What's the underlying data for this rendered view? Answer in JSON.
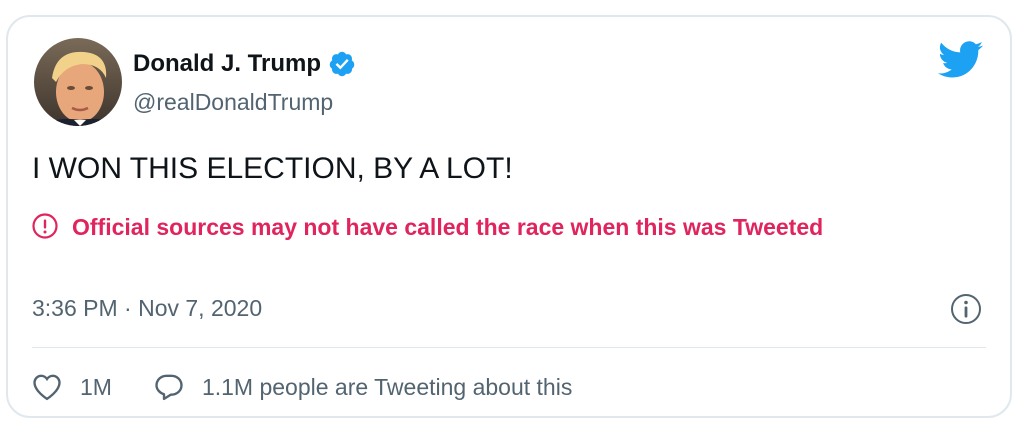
{
  "author": {
    "name": "Donald J. Trump",
    "handle": "@realDonaldTrump",
    "verified": true
  },
  "tweet": {
    "text": "I WON THIS ELECTION, BY A LOT!",
    "notice": "Official sources may not have called the race when this was Tweeted",
    "timestamp": "3:36 PM · Nov 7, 2020"
  },
  "actions": {
    "likes": "1M",
    "conversation": "1.1M people are Tweeting about this"
  },
  "icons": {
    "verified": "verified-badge-icon",
    "brand": "twitter-bird-icon",
    "notice": "exclamation-circle-icon",
    "info": "info-icon",
    "like": "heart-icon",
    "reply": "speech-bubble-icon"
  },
  "colors": {
    "brand": "#1da1f2",
    "notice": "#e0245e",
    "secondary_text": "#536471",
    "border": "#e1e8ed"
  }
}
